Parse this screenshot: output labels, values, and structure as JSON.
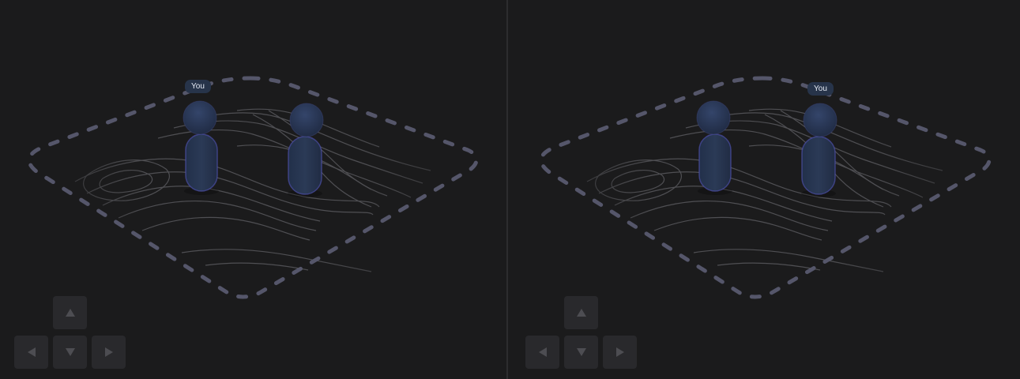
{
  "viewports": [
    {
      "player_tag": "You",
      "controls": {
        "up": "arrow-up-icon",
        "left": "arrow-left-icon",
        "down": "arrow-down-icon",
        "right": "arrow-right-icon"
      }
    },
    {
      "player_tag": "You",
      "controls": {
        "up": "arrow-up-icon",
        "left": "arrow-left-icon",
        "down": "arrow-down-icon",
        "right": "arrow-right-icon"
      }
    }
  ],
  "colors": {
    "background": "#1b1b1c",
    "dash_border": "#55566a",
    "contour": "#7a7a80",
    "avatar_body": "#27344a",
    "avatar_rim": "#5a5ab8",
    "tag_bg": "#27344a",
    "tag_text": "#e6ebf5",
    "dpad_button": "#29292c",
    "dpad_arrow": "#4d4d52"
  }
}
